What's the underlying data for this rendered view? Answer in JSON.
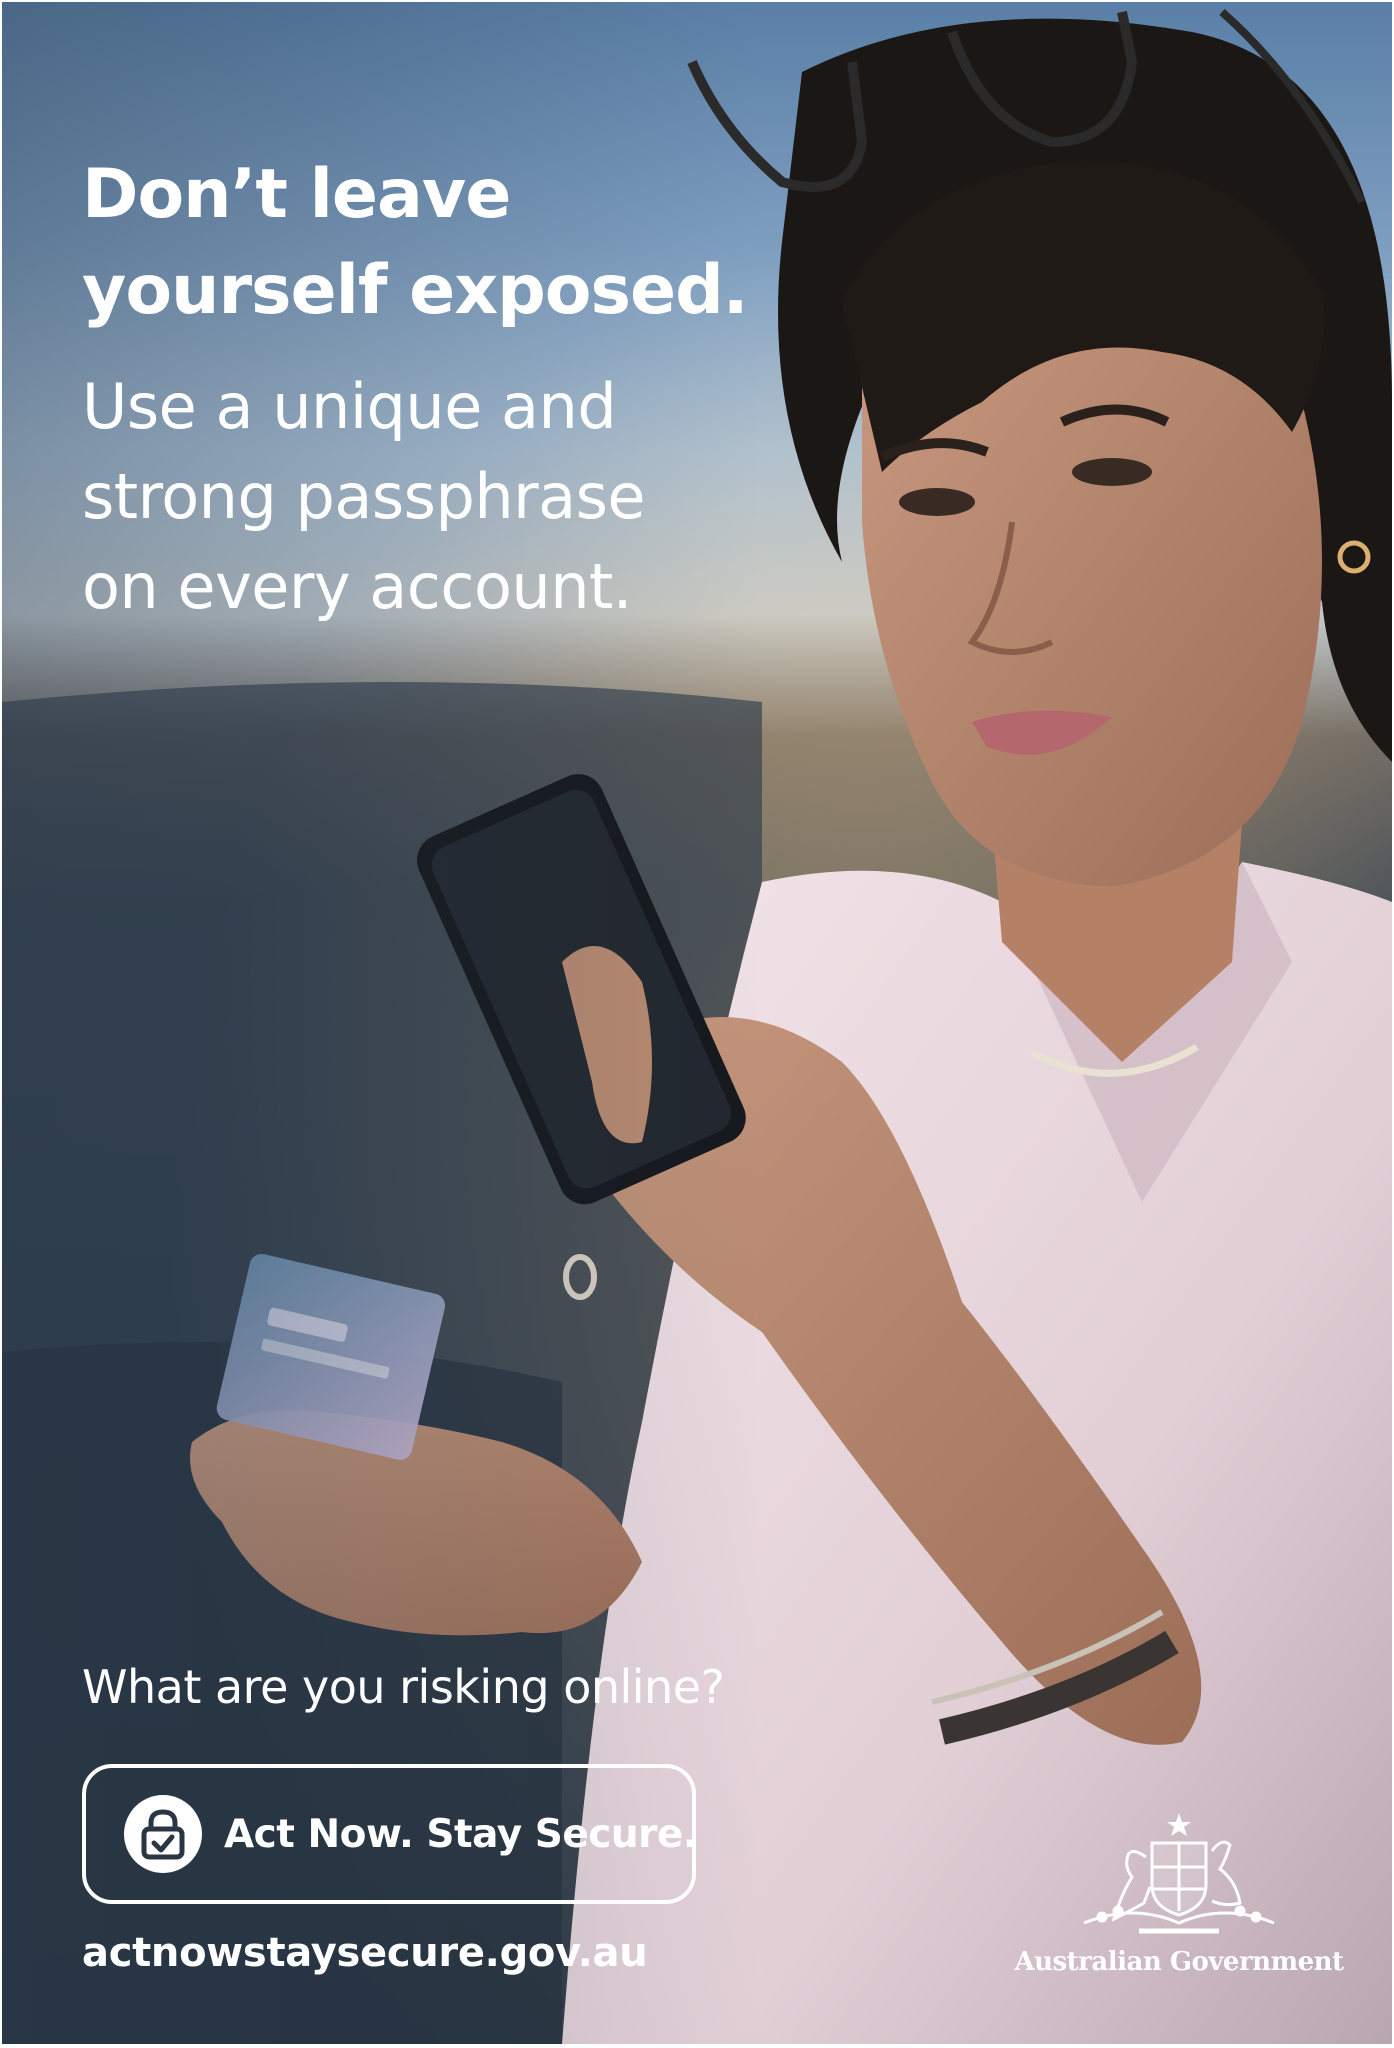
{
  "poster": {
    "headline": [
      "Don’t leave",
      "yourself exposed."
    ],
    "subline": [
      "Use a unique and",
      "strong passphrase",
      "on every account."
    ],
    "question": "What are you risking online?",
    "cta_label": "Act Now. Stay Secure.",
    "url": "actnowstaysecure.gov.au",
    "government": "Australian Government"
  },
  "icons": {
    "cta": "lock-check-icon",
    "emblem": "coat-of-arms-emblem"
  }
}
